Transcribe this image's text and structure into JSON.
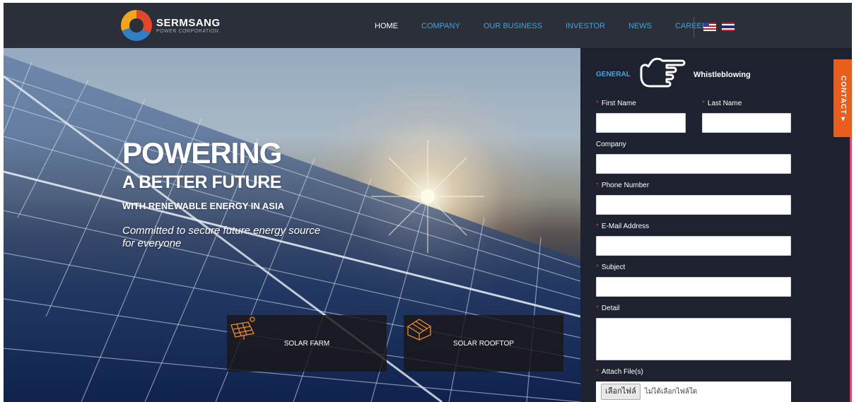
{
  "brand": {
    "name": "SERMSANG",
    "tagline": "POWER CORPORATION"
  },
  "nav": {
    "items": [
      {
        "label": "HOME",
        "active": true
      },
      {
        "label": "COMPANY",
        "active": false
      },
      {
        "label": "OUR BUSINESS",
        "active": false
      },
      {
        "label": "INVESTOR",
        "active": false
      },
      {
        "label": "NEWS",
        "active": false
      },
      {
        "label": "CAREER",
        "active": false
      }
    ],
    "languages": [
      "us-flag-icon",
      "th-flag-icon"
    ]
  },
  "hero": {
    "title": "POWERING",
    "subtitle": "A BETTER FUTURE",
    "subtitle2": "WITH RENEWABLE ENERGY IN ASIA",
    "tagline": "Committed to secure future energy source for everyone",
    "tiles": [
      {
        "label": "SOLAR FARM",
        "icon": "solar-farm-icon"
      },
      {
        "label": "SOLAR ROOFTOP",
        "icon": "solar-rooftop-icon"
      }
    ]
  },
  "form": {
    "tabs": {
      "general": "GENERAL",
      "whistleblowing": "Whistleblowing"
    },
    "fields": {
      "first_name": "First Name",
      "last_name": "Last Name",
      "company": "Company",
      "phone": "Phone Number",
      "email": "E-Mail Address",
      "subject": "Subject",
      "detail": "Detail",
      "attach": "Attach File(s)"
    },
    "required_mark": "*",
    "file_button": "เลือกไฟล์",
    "file_none": "ไม่ได้เลือกไฟล์ใด"
  },
  "contact_tab": "CONTACT ▸",
  "colors": {
    "accent": "#3aa7e0",
    "header_bg": "#2b2f3a",
    "panel_bg": "#1d2130",
    "contact": "#e95d1d",
    "required": "#d23a3a"
  }
}
